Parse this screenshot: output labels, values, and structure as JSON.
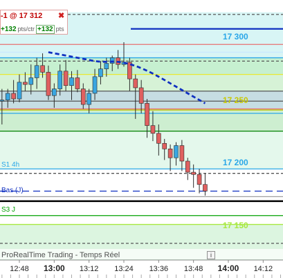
{
  "order": {
    "title": "-1 @ 17 312",
    "close_glyph": "✖",
    "pts_per_contract": "+132",
    "pts_per_contract_unit": "pts/ctr",
    "pts_total": "+132",
    "pts_total_unit": "pts"
  },
  "watermark": "ProRealTime Trading - Temps Réel",
  "colors": {
    "up": "#3aa6e0",
    "down": "#e06060",
    "level_fill_green": "#cdeed0",
    "level_fill_blue": "#c6dde2",
    "resistance": "#2aa7e8",
    "support_green": "#00a000",
    "yellow": "#e8e830",
    "average": "#1030c0"
  },
  "chart_data": {
    "type": "candlestick",
    "instrument_price_labels": [
      "17 300",
      "17 250",
      "17 200",
      "17 150"
    ],
    "level_labels": [
      "S1 4h",
      "Bas (J)",
      "S3 J"
    ],
    "x_ticks": [
      "12:48",
      "13:00",
      "13:12",
      "13:24",
      "13:36",
      "13:48",
      "14:00",
      "14:12"
    ],
    "y_range": [
      17118,
      17352
    ],
    "candles": [
      {
        "t": "12:42",
        "o": 17262,
        "h": 17272,
        "l": 17240,
        "c": 17262
      },
      {
        "t": "12:44",
        "o": 17262,
        "h": 17272,
        "l": 17255,
        "c": 17268
      },
      {
        "t": "12:46",
        "o": 17268,
        "h": 17280,
        "l": 17259,
        "c": 17263
      },
      {
        "t": "12:48",
        "o": 17263,
        "h": 17285,
        "l": 17260,
        "c": 17278
      },
      {
        "t": "12:50",
        "o": 17278,
        "h": 17287,
        "l": 17270,
        "c": 17276
      },
      {
        "t": "12:52",
        "o": 17276,
        "h": 17294,
        "l": 17267,
        "c": 17282
      },
      {
        "t": "12:54",
        "o": 17282,
        "h": 17300,
        "l": 17272,
        "c": 17293
      },
      {
        "t": "12:56",
        "o": 17293,
        "h": 17304,
        "l": 17282,
        "c": 17287
      },
      {
        "t": "12:58",
        "o": 17287,
        "h": 17293,
        "l": 17262,
        "c": 17266
      },
      {
        "t": "13:00",
        "o": 17266,
        "h": 17277,
        "l": 17255,
        "c": 17272
      },
      {
        "t": "13:02",
        "o": 17272,
        "h": 17294,
        "l": 17266,
        "c": 17288
      },
      {
        "t": "13:04",
        "o": 17288,
        "h": 17298,
        "l": 17270,
        "c": 17275
      },
      {
        "t": "13:06",
        "o": 17275,
        "h": 17288,
        "l": 17262,
        "c": 17282
      },
      {
        "t": "13:08",
        "o": 17282,
        "h": 17289,
        "l": 17269,
        "c": 17272
      },
      {
        "t": "13:10",
        "o": 17272,
        "h": 17277,
        "l": 17254,
        "c": 17258
      },
      {
        "t": "13:12",
        "o": 17258,
        "h": 17272,
        "l": 17250,
        "c": 17268
      },
      {
        "t": "13:14",
        "o": 17268,
        "h": 17290,
        "l": 17262,
        "c": 17283
      },
      {
        "t": "13:16",
        "o": 17283,
        "h": 17297,
        "l": 17276,
        "c": 17290
      },
      {
        "t": "13:18",
        "o": 17290,
        "h": 17300,
        "l": 17283,
        "c": 17295
      },
      {
        "t": "13:20",
        "o": 17295,
        "h": 17302,
        "l": 17288,
        "c": 17300
      },
      {
        "t": "13:22",
        "o": 17300,
        "h": 17307,
        "l": 17290,
        "c": 17294
      },
      {
        "t": "13:24",
        "o": 17294,
        "h": 17314,
        "l": 17292,
        "c": 17296
      },
      {
        "t": "13:26",
        "o": 17296,
        "h": 17300,
        "l": 17270,
        "c": 17281
      },
      {
        "t": "13:28",
        "o": 17281,
        "h": 17285,
        "l": 17245,
        "c": 17273
      },
      {
        "t": "13:30",
        "o": 17273,
        "h": 17280,
        "l": 17250,
        "c": 17259
      },
      {
        "t": "13:32",
        "o": 17259,
        "h": 17263,
        "l": 17228,
        "c": 17239
      },
      {
        "t": "13:34",
        "o": 17239,
        "h": 17252,
        "l": 17225,
        "c": 17232
      },
      {
        "t": "13:36",
        "o": 17232,
        "h": 17240,
        "l": 17212,
        "c": 17223
      },
      {
        "t": "13:38",
        "o": 17223,
        "h": 17227,
        "l": 17208,
        "c": 17218
      },
      {
        "t": "13:40",
        "o": 17218,
        "h": 17222,
        "l": 17198,
        "c": 17210
      },
      {
        "t": "13:42",
        "o": 17210,
        "h": 17224,
        "l": 17203,
        "c": 17221
      },
      {
        "t": "13:44",
        "o": 17221,
        "h": 17226,
        "l": 17198,
        "c": 17207
      },
      {
        "t": "13:46",
        "o": 17207,
        "h": 17210,
        "l": 17190,
        "c": 17197
      },
      {
        "t": "13:48",
        "o": 17197,
        "h": 17204,
        "l": 17183,
        "c": 17195
      },
      {
        "t": "13:50",
        "o": 17195,
        "h": 17200,
        "l": 17178,
        "c": 17186
      },
      {
        "t": "13:52",
        "o": 17186,
        "h": 17196,
        "l": 17176,
        "c": 17180
      }
    ],
    "average": {
      "style": "dashed",
      "points": [
        {
          "t": "12:58",
          "v": 17305
        },
        {
          "t": "13:04",
          "v": 17302
        },
        {
          "t": "13:10",
          "v": 17299
        },
        {
          "t": "13:16",
          "v": 17296
        },
        {
          "t": "13:22",
          "v": 17297
        },
        {
          "t": "13:28",
          "v": 17293
        },
        {
          "t": "13:34",
          "v": 17286
        },
        {
          "t": "13:40",
          "v": 17277
        },
        {
          "t": "13:46",
          "v": 17268
        },
        {
          "t": "13:52",
          "v": 17259
        }
      ]
    },
    "top_line": {
      "from": "13:24",
      "v": 17326
    },
    "levels": [
      {
        "v": 17339,
        "style": "dashed",
        "color": "#555555"
      },
      {
        "v": 17312,
        "style": "solid",
        "color": "#e87070"
      },
      {
        "v": 17305,
        "style": "solid",
        "color": "#c8e8ff"
      },
      {
        "v": 17300,
        "style": "solid",
        "color": "#2aa7e8"
      },
      {
        "v": 17297,
        "style": "dashed",
        "color": "#555555"
      },
      {
        "v": 17285,
        "style": "solid",
        "color": "#e8e830"
      },
      {
        "v": 17270,
        "style": "solid",
        "color": "#555555"
      },
      {
        "v": 17261,
        "style": "solid",
        "color": "#555555"
      },
      {
        "v": 17254,
        "style": "solid",
        "color": "#e87070"
      },
      {
        "v": 17253,
        "style": "solid",
        "color": "#c0c000"
      },
      {
        "v": 17250,
        "style": "solid",
        "color": "#2aa7e8"
      },
      {
        "v": 17234,
        "style": "solid",
        "color": "#008000"
      },
      {
        "v": 17200,
        "style": "solid",
        "color": "#2aa7e8"
      },
      {
        "v": 17196,
        "style": "dashed",
        "color": "#555555"
      },
      {
        "v": 17180,
        "style": "dashed",
        "color": "#1030c0"
      },
      {
        "v": 17175,
        "style": "solid",
        "color": "#a0a0a0"
      },
      {
        "v": 17171,
        "style": "solid",
        "color": "#000000"
      },
      {
        "v": 17158,
        "style": "solid",
        "color": "#00a000"
      },
      {
        "v": 17150,
        "style": "solid",
        "color": "#a8e840"
      },
      {
        "v": 17133,
        "style": "dashed",
        "color": "#555555"
      }
    ],
    "zones": [
      {
        "from": 17341,
        "to": 17300,
        "color": "#d8f5f5"
      },
      {
        "from": 17300,
        "to": 17285,
        "color": "#c6f0d0"
      },
      {
        "from": 17285,
        "to": 17270,
        "color": "#d6f2d6"
      },
      {
        "from": 17270,
        "to": 17254,
        "color": "#c6dde2"
      },
      {
        "from": 17254,
        "to": 17234,
        "color": "#cdeed0"
      },
      {
        "from": 17234,
        "to": 17200,
        "color": "#e4f8ec"
      },
      {
        "from": 17200,
        "to": 17171,
        "color": "#ffffff"
      },
      {
        "from": 17150,
        "to": 17118,
        "color": "#dcf5e0"
      }
    ]
  }
}
